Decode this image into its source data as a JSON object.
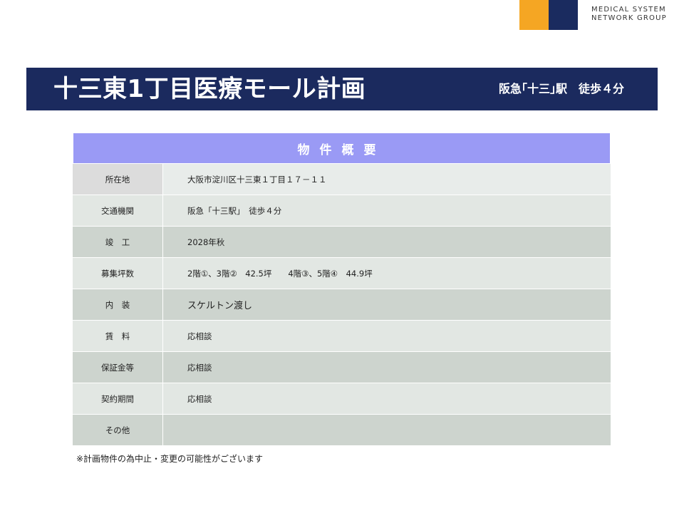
{
  "logo": {
    "line1": "MEDICAL SYSTEM",
    "line2": "NETWORK GROUP",
    "colors": {
      "orange": "#f5a623",
      "navy": "#1a2b5f"
    }
  },
  "banner": {
    "title": "十三東1丁目医療モール計画",
    "subtitle": "阪急｢十三｣駅　徒歩４分"
  },
  "table": {
    "header": "物件概要",
    "rows": [
      {
        "label": "所在地",
        "value": "大阪市淀川区十三東１丁目１７－１１"
      },
      {
        "label": "交通機関",
        "value": "阪急「十三駅」　徒歩４分"
      },
      {
        "label": "竣　工",
        "value": "2028年秋"
      },
      {
        "label": "募集坪数",
        "value": "2階①、3階②　42.5坪　　4階③、5階④　44.9坪"
      },
      {
        "label": "内　装",
        "value": "スケルトン渡し"
      },
      {
        "label": "賃　料",
        "value": "応相談"
      },
      {
        "label": "保証金等",
        "value": "応相談"
      },
      {
        "label": "契約期間",
        "value": "応相談"
      },
      {
        "label": "その他",
        "value": ""
      }
    ]
  },
  "note": "※計画物件の為中止・変更の可能性がございます"
}
